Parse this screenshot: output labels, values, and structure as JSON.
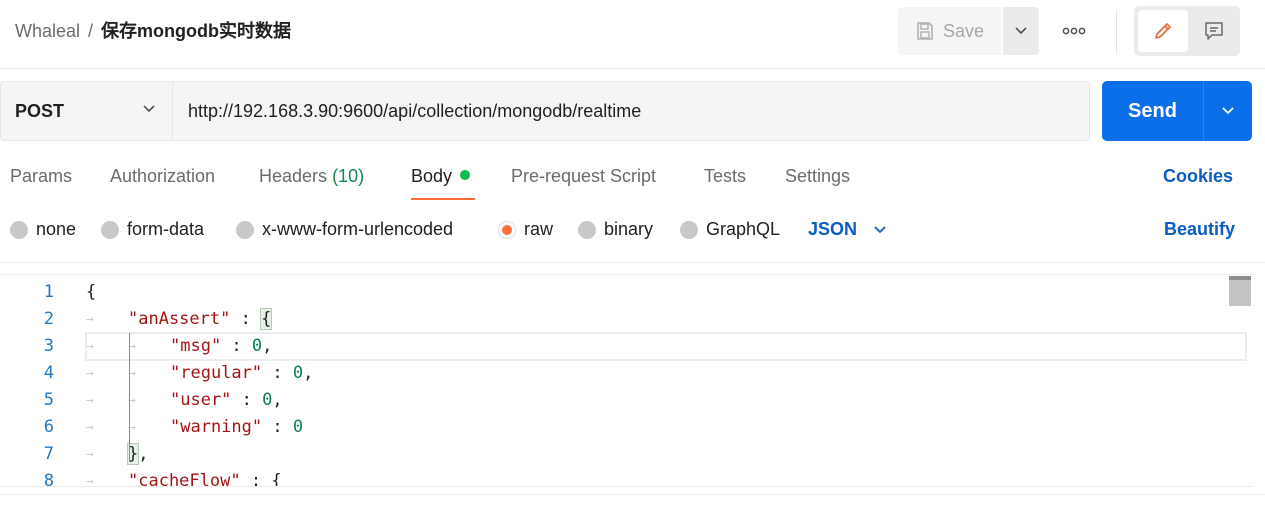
{
  "header": {
    "workspace": "Whaleal",
    "separator": "/",
    "request_name": "保存mongodb实时数据",
    "save_label": "Save",
    "icons": {
      "save": "save-icon",
      "caret": "chevron-down-icon",
      "more": "more-horizontal-icon",
      "edit": "pencil-icon",
      "doc": "comment-icon"
    }
  },
  "request": {
    "method": "POST",
    "url": "http://192.168.3.90:9600/api/collection/mongodb/realtime",
    "send_label": "Send"
  },
  "tabs": [
    {
      "label": "Params"
    },
    {
      "label": "Authorization"
    },
    {
      "label": "Headers",
      "count": "(10)"
    },
    {
      "label": "Body",
      "active": true
    },
    {
      "label": "Pre-request Script"
    },
    {
      "label": "Tests"
    },
    {
      "label": "Settings"
    }
  ],
  "cookies_label": "Cookies",
  "body_types": [
    {
      "label": "none"
    },
    {
      "label": "form-data"
    },
    {
      "label": "x-www-form-urlencoded"
    },
    {
      "label": "raw",
      "selected": true
    },
    {
      "label": "binary"
    },
    {
      "label": "GraphQL"
    }
  ],
  "format_select": "JSON",
  "beautify_label": "Beautify",
  "editor": {
    "line_numbers": [
      "1",
      "2",
      "3",
      "4",
      "5",
      "6",
      "7",
      "8"
    ],
    "lines": [
      {
        "parts": [
          [
            "p",
            "{"
          ]
        ]
      },
      {
        "parts": [
          [
            "k",
            "\"anAssert\""
          ],
          [
            "p",
            " : "
          ],
          [
            "b",
            "{"
          ]
        ]
      },
      {
        "parts": [
          [
            "k",
            "\"msg\""
          ],
          [
            "p",
            " : "
          ],
          [
            "n",
            "0"
          ],
          [
            "p",
            ","
          ]
        ]
      },
      {
        "parts": [
          [
            "k",
            "\"regular\""
          ],
          [
            "p",
            " : "
          ],
          [
            "n",
            "0"
          ],
          [
            "p",
            ","
          ]
        ]
      },
      {
        "parts": [
          [
            "k",
            "\"user\""
          ],
          [
            "p",
            " : "
          ],
          [
            "n",
            "0"
          ],
          [
            "p",
            ","
          ]
        ]
      },
      {
        "parts": [
          [
            "k",
            "\"warning\""
          ],
          [
            "p",
            " : "
          ],
          [
            "n",
            "0"
          ]
        ]
      },
      {
        "parts": [
          [
            "b",
            "}"
          ],
          [
            "p",
            ","
          ]
        ]
      },
      {
        "parts": [
          [
            "k",
            "\"cacheFlow\""
          ],
          [
            "p",
            " : "
          ],
          [
            "p",
            "{"
          ]
        ]
      }
    ]
  },
  "colors": {
    "accent": "#ff6c37",
    "send": "#0a6fe8",
    "link": "#0a5cc4",
    "status_dot": "#0cbb52"
  }
}
